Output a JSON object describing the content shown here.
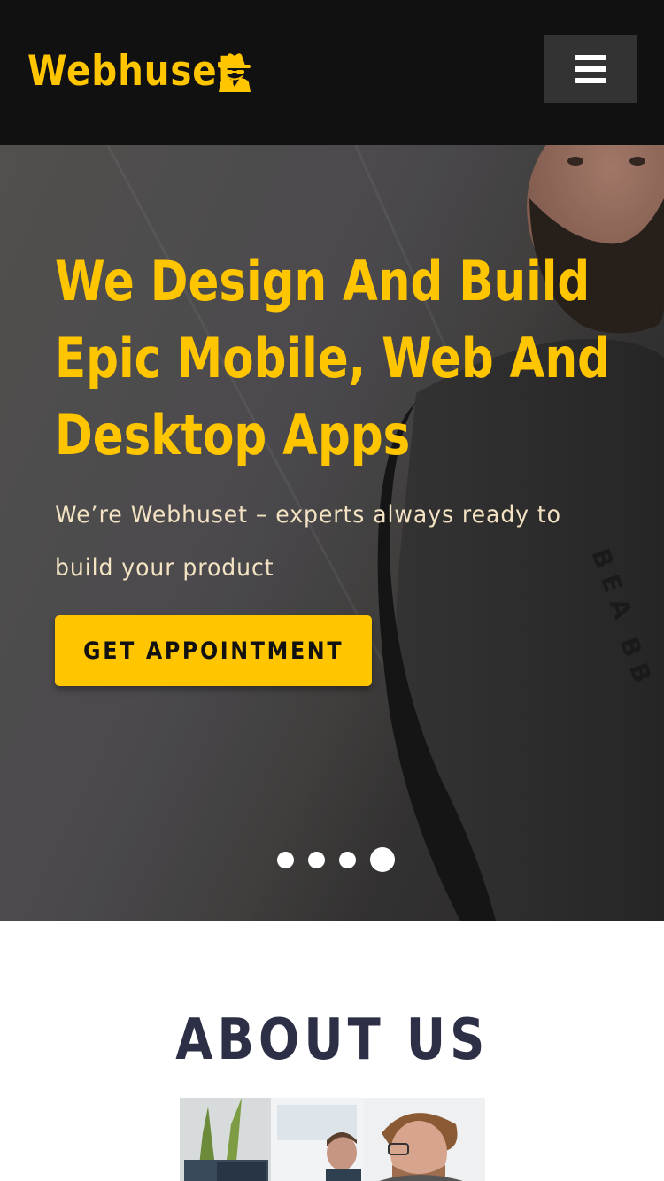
{
  "header": {
    "brand_name": "Webhuset",
    "brand_icon": "spy-icon",
    "menu_icon": "hamburger-menu-icon"
  },
  "hero": {
    "title": "We Design And Build Epic Mobile, Web And Desktop Apps",
    "subtitle": "We’re Webhuset – experts always ready to build your product",
    "cta_label": "GET APPOINTMENT",
    "slides": {
      "count": 4,
      "active_index": 3
    }
  },
  "about": {
    "title": "ABOUT US"
  },
  "colors": {
    "accent": "#ffc600",
    "header_bg": "#111111",
    "menu_bg": "#333333",
    "heading_dark": "#2c2f45",
    "subtitle_text": "#f3e3c3"
  }
}
